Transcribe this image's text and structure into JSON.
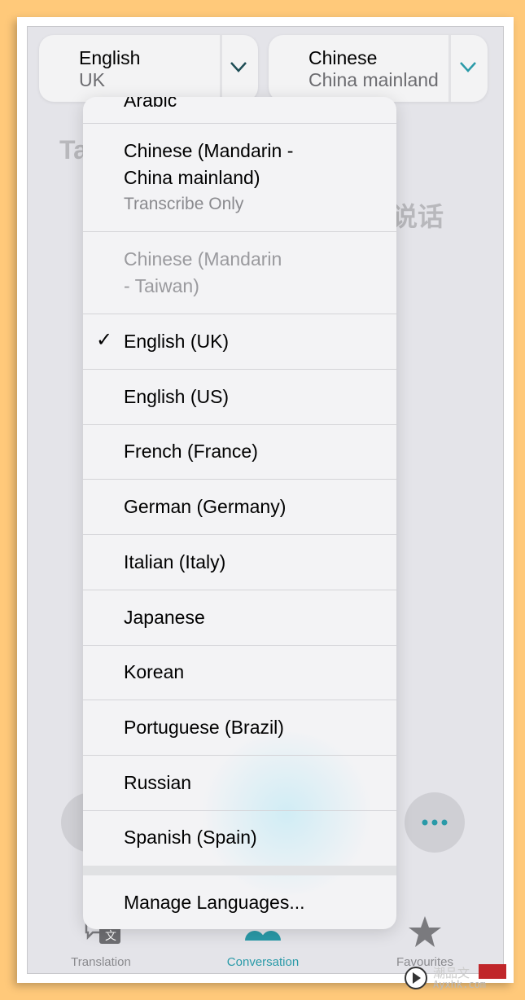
{
  "source_lang": {
    "name": "English",
    "region": "UK"
  },
  "target_lang": {
    "name": "Chinese",
    "region": "China mainland"
  },
  "background": {
    "left_text": "Ta",
    "right_text": "来说话"
  },
  "menu": {
    "items": [
      {
        "label": "Arabic"
      },
      {
        "label": "Chinese (Mandarin - China mainland)",
        "line1": "Chinese (Mandarin -",
        "line2": "China mainland)",
        "sub": "Transcribe Only"
      },
      {
        "label": "Chinese (Mandarin - Taiwan)",
        "line1": "Chinese (Mandarin",
        "line2": "- Taiwan)",
        "disabled": true
      },
      {
        "label": "English (UK)",
        "checked": true
      },
      {
        "label": "English (US)"
      },
      {
        "label": "French (France)"
      },
      {
        "label": "German (Germany)"
      },
      {
        "label": "Italian (Italy)"
      },
      {
        "label": "Japanese"
      },
      {
        "label": "Korean"
      },
      {
        "label": "Portuguese (Brazil)"
      },
      {
        "label": "Russian"
      },
      {
        "label": "Spanish (Spain)"
      }
    ],
    "check_glyph": "✓",
    "manage": "Manage Languages..."
  },
  "tabs": [
    {
      "label": "Translation"
    },
    {
      "label": "Conversation",
      "active": true
    },
    {
      "label": "Favourites"
    }
  ],
  "colors": {
    "accent": "#2a9aa8",
    "page_bg": "#ffc97a"
  },
  "watermark": {
    "line1": "潮品文",
    "line2": "Ayxhk.com"
  }
}
